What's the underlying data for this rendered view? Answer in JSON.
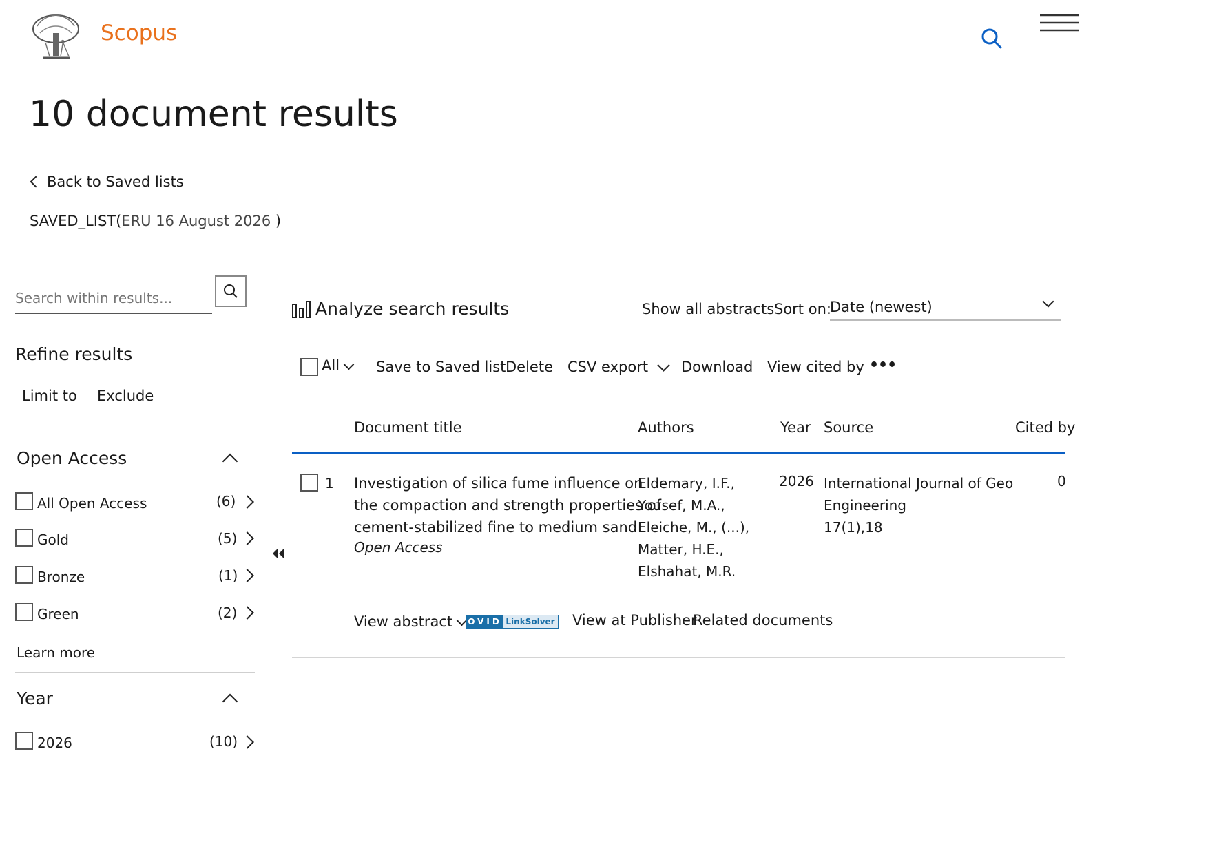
{
  "header": {
    "brand": "Scopus",
    "brand_color": "#e9711c",
    "logo_icon": "elsevier-tree-logo",
    "search_icon": "search-icon",
    "menu_icon": "hamburger-menu-icon"
  },
  "page": {
    "title": "10 document results",
    "back_link": "Back to Saved lists",
    "saved_list_prefix": "SAVED_LIST(",
    "saved_list_name": "ERU 16 August 2026",
    "saved_list_suffix": ")"
  },
  "sidebar": {
    "search_placeholder": "Search within results...",
    "refine_title": "Refine results",
    "limit_to": "Limit to",
    "exclude": "Exclude",
    "open_access": {
      "title": "Open Access",
      "items": [
        {
          "label": "All Open Access",
          "count": "(6)"
        },
        {
          "label": "Gold",
          "count": "(5)"
        },
        {
          "label": "Bronze",
          "count": "(1)"
        },
        {
          "label": "Green",
          "count": "(2)"
        }
      ],
      "learn_more": "Learn more"
    },
    "year": {
      "title": "Year",
      "items": [
        {
          "label": "2026",
          "count": "(10)"
        }
      ]
    }
  },
  "toolbar": {
    "analyze": "Analyze search results",
    "show_abstracts": "Show all abstracts",
    "sort_label": "Sort on:",
    "sort_value": "Date (newest)",
    "all": "All",
    "save": "Save to Saved list",
    "delete": "Delete",
    "csv": "CSV export",
    "download": "Download",
    "view_cited": "View cited by",
    "more": "•••"
  },
  "table": {
    "columns": {
      "title": "Document title",
      "authors": "Authors",
      "year": "Year",
      "source": "Source",
      "cited": "Cited by"
    },
    "rows": [
      {
        "index": "1",
        "title_lines": [
          "Investigation of silica fume influence on",
          "the compaction and strength properties of",
          "cement-stabilized fine to medium sand"
        ],
        "access": "Open Access",
        "authors": [
          "Eldemary, I.F.,",
          "Yousef, M.A.,",
          "Eleiche, M., (...),",
          "Matter, H.E.,",
          "Elshahat, M.R."
        ],
        "year": "2026",
        "source_lines": [
          "International Journal of Geo",
          "Engineering",
          "17(1),18"
        ],
        "cited": "0",
        "actions": {
          "view_abstract": "View abstract",
          "ovid": "OVID",
          "linksolver": "LinkSolver",
          "publisher": "View at Publisher",
          "related": "Related documents"
        }
      }
    ]
  },
  "colors": {
    "accent_blue": "#0a5fc4",
    "ovid_blue": "#1a6fa8"
  }
}
